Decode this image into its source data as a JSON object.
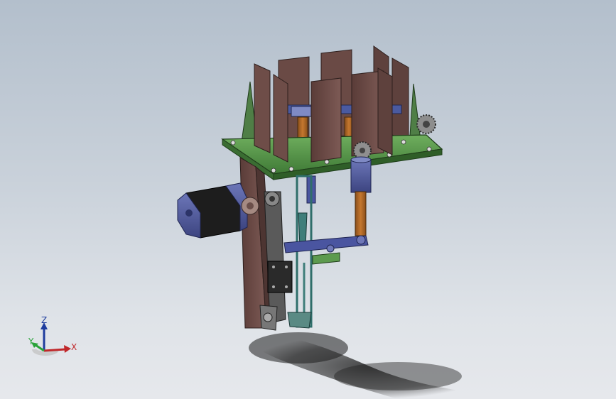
{
  "viewport": {
    "background_top": "#b3bfcc",
    "background_bottom": "#e6e8ec"
  },
  "triad": {
    "x_label": "X",
    "y_label": "Y",
    "z_label": "Z",
    "x_color": "#c0282b",
    "y_color": "#2aa33a",
    "z_color": "#1f3d9e"
  },
  "model": {
    "plate_color": "#5c9a4e",
    "panel_color": "#6b4a45",
    "motor_color": "#555fa0",
    "rod_color": "#b06a2a",
    "link_color": "#3f7e7a",
    "frame_color": "#7b5a56"
  }
}
